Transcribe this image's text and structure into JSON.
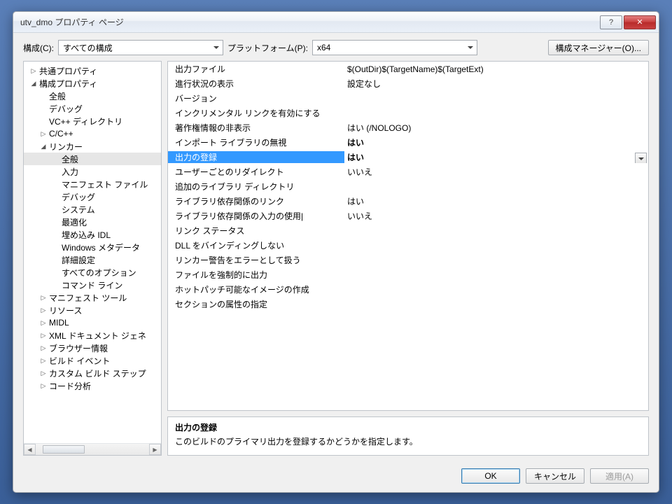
{
  "window": {
    "title": "utv_dmo プロパティ ページ"
  },
  "toolbar": {
    "config_label": "構成(C):",
    "config_value": "すべての構成",
    "platform_label": "プラットフォーム(P):",
    "platform_value": "x64",
    "manager_label": "構成マネージャー(O)..."
  },
  "tree": [
    {
      "label": "共通プロパティ",
      "depth": 1,
      "arrow": "▷"
    },
    {
      "label": "構成プロパティ",
      "depth": 1,
      "arrow": "◢"
    },
    {
      "label": "全般",
      "depth": 2,
      "arrow": ""
    },
    {
      "label": "デバッグ",
      "depth": 2,
      "arrow": ""
    },
    {
      "label": "VC++ ディレクトリ",
      "depth": 2,
      "arrow": ""
    },
    {
      "label": "C/C++",
      "depth": 2,
      "arrow": "▷"
    },
    {
      "label": "リンカー",
      "depth": 2,
      "arrow": "◢"
    },
    {
      "label": "全般",
      "depth": 3,
      "arrow": "",
      "selected": true
    },
    {
      "label": "入力",
      "depth": 3,
      "arrow": ""
    },
    {
      "label": "マニフェスト ファイル",
      "depth": 3,
      "arrow": ""
    },
    {
      "label": "デバッグ",
      "depth": 3,
      "arrow": ""
    },
    {
      "label": "システム",
      "depth": 3,
      "arrow": ""
    },
    {
      "label": "最適化",
      "depth": 3,
      "arrow": ""
    },
    {
      "label": "埋め込み IDL",
      "depth": 3,
      "arrow": ""
    },
    {
      "label": "Windows メタデータ",
      "depth": 3,
      "arrow": ""
    },
    {
      "label": "詳細設定",
      "depth": 3,
      "arrow": ""
    },
    {
      "label": "すべてのオプション",
      "depth": 3,
      "arrow": ""
    },
    {
      "label": "コマンド ライン",
      "depth": 3,
      "arrow": ""
    },
    {
      "label": "マニフェスト ツール",
      "depth": 2,
      "arrow": "▷"
    },
    {
      "label": "リソース",
      "depth": 2,
      "arrow": "▷"
    },
    {
      "label": "MIDL",
      "depth": 2,
      "arrow": "▷"
    },
    {
      "label": "XML ドキュメント ジェネ",
      "depth": 2,
      "arrow": "▷"
    },
    {
      "label": "ブラウザー情報",
      "depth": 2,
      "arrow": "▷"
    },
    {
      "label": "ビルド イベント",
      "depth": 2,
      "arrow": "▷"
    },
    {
      "label": "カスタム ビルド ステップ",
      "depth": 2,
      "arrow": "▷"
    },
    {
      "label": "コード分析",
      "depth": 2,
      "arrow": "▷"
    }
  ],
  "props": [
    {
      "name": "出力ファイル",
      "value": "$(OutDir)$(TargetName)$(TargetExt)"
    },
    {
      "name": "進行状況の表示",
      "value": "設定なし"
    },
    {
      "name": "バージョン",
      "value": ""
    },
    {
      "name": "インクリメンタル リンクを有効にする",
      "value": ""
    },
    {
      "name": "著作権情報の非表示",
      "value": "はい (/NOLOGO)"
    },
    {
      "name": "インポート ライブラリの無視",
      "value": "はい",
      "bold": true
    },
    {
      "name": "出力の登録",
      "value": "はい",
      "bold": true,
      "selected": true
    },
    {
      "name": "ユーザーごとのリダイレクト",
      "value": "いいえ"
    },
    {
      "name": "追加のライブラリ ディレクトリ",
      "value": ""
    },
    {
      "name": "ライブラリ依存関係のリンク",
      "value": "はい"
    },
    {
      "name": "ライブラリ依存関係の入力の使用|",
      "value": "いいえ"
    },
    {
      "name": "リンク ステータス",
      "value": ""
    },
    {
      "name": "DLL をバインディングしない",
      "value": ""
    },
    {
      "name": "リンカー警告をエラーとして扱う",
      "value": ""
    },
    {
      "name": "ファイルを強制的に出力",
      "value": ""
    },
    {
      "name": "ホットパッチ可能なイメージの作成",
      "value": ""
    },
    {
      "name": "セクションの属性の指定",
      "value": ""
    }
  ],
  "desc": {
    "heading": "出力の登録",
    "text": "このビルドのプライマリ出力を登録するかどうかを指定します。"
  },
  "footer": {
    "ok": "OK",
    "cancel": "キャンセル",
    "apply": "適用(A)"
  }
}
